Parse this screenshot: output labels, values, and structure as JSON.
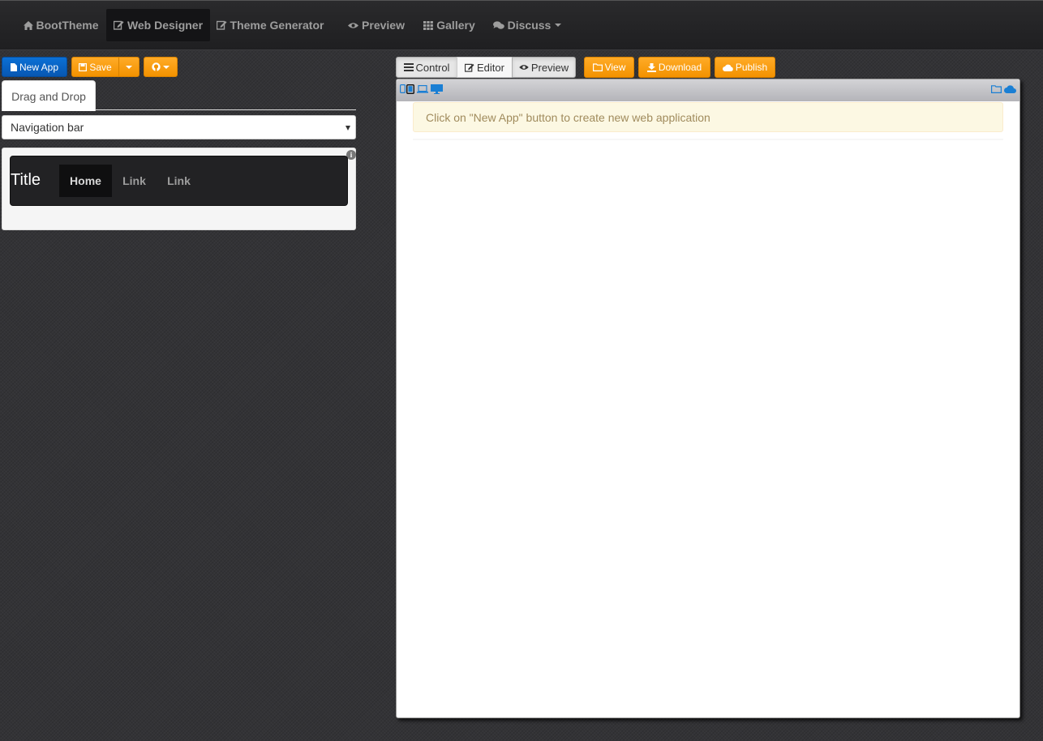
{
  "navbar": {
    "items": [
      {
        "label": "BootTheme",
        "icon": "home-icon"
      },
      {
        "label": "Web Designer",
        "icon": "edit-icon",
        "active": true
      },
      {
        "label": "Theme Generator",
        "icon": "edit-icon"
      },
      {
        "label": "Preview",
        "icon": "eye-icon"
      },
      {
        "label": "Gallery",
        "icon": "grid-icon"
      },
      {
        "label": "Discuss",
        "icon": "comments-icon",
        "dropdown": true
      }
    ]
  },
  "left_toolbar": {
    "new_app": "New App",
    "save": "Save",
    "github_icon": "github-icon"
  },
  "left_panel": {
    "tab_label": "Drag and Drop",
    "select_value": "Navigation bar",
    "widget_preview": {
      "brand": "Title",
      "links": [
        "Home",
        "Link",
        "Link"
      ]
    }
  },
  "right_toolbar": {
    "control": "Control",
    "editor": "Editor",
    "preview": "Preview",
    "view": "View",
    "download": "Download",
    "publish": "Publish"
  },
  "preview_frame": {
    "device_icons": [
      "tablet-icon",
      "phone-icon",
      "laptop-icon",
      "desktop-icon"
    ],
    "right_icons": [
      "folder-icon",
      "cloud-icon"
    ],
    "alert_text": "Click on \"New App\" button to create new web application"
  },
  "colors": {
    "navbar_bg": "#222224",
    "body_bg": "#333336",
    "primary": "#0b70d6",
    "warning": "#f39200",
    "alert_bg": "#fcf8e3",
    "alert_text": "#a08b5d"
  }
}
